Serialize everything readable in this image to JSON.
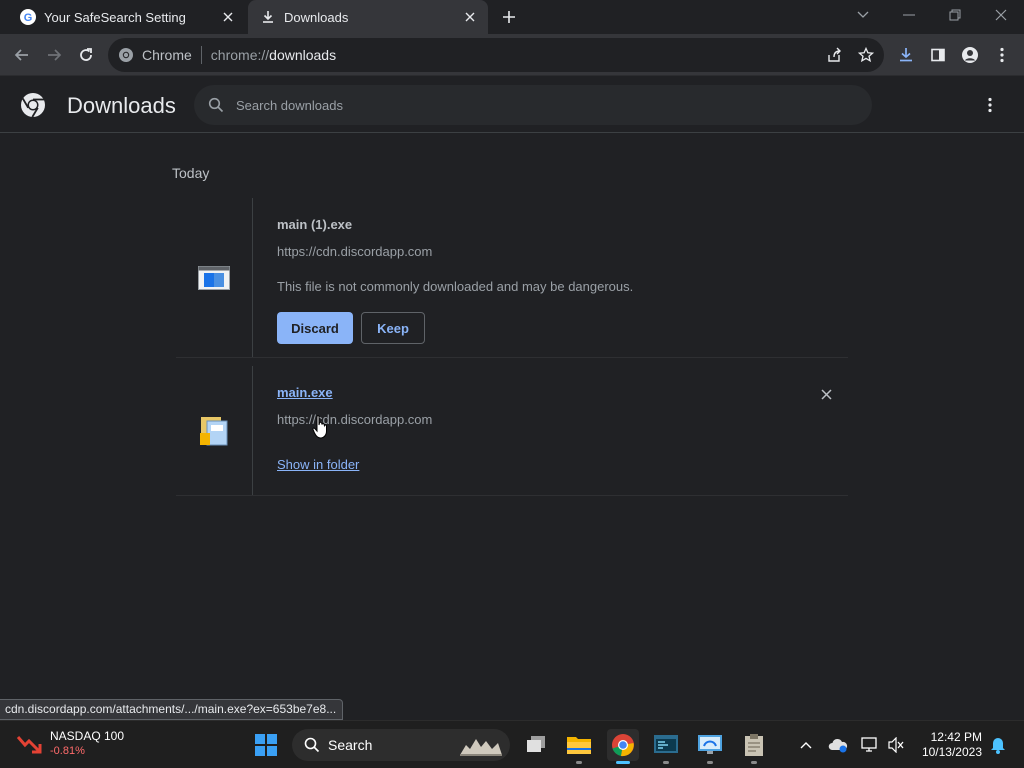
{
  "tabs": [
    {
      "title": "Your SafeSearch Setting",
      "favicon": "google-icon"
    },
    {
      "title": "Downloads",
      "favicon": "download-icon"
    }
  ],
  "omnibox": {
    "chip": "Chrome",
    "scheme": "chrome://",
    "host": "downloads"
  },
  "page": {
    "title": "Downloads",
    "search_placeholder": "Search downloads",
    "date_label": "Today"
  },
  "downloads": [
    {
      "filename": "main (1).exe",
      "url": "https://cdn.discordapp.com",
      "warning": "This file is not commonly downloaded and may be dangerous.",
      "discard_label": "Discard",
      "keep_label": "Keep"
    },
    {
      "filename": "main.exe",
      "url": "https://cdn.discordapp.com",
      "show_in_folder": "Show in folder"
    }
  ],
  "status_url": "cdn.discordapp.com/attachments/.../main.exe?ex=653be7e8...",
  "taskbar": {
    "widget_name": "NASDAQ 100",
    "widget_value": "-0.81%",
    "search_label": "Search",
    "time": "12:42 PM",
    "date": "10/13/2023"
  },
  "colors": {
    "accent": "#8ab4f8",
    "background": "#202124",
    "toolbar": "#35363a",
    "negative": "#ff6b6b"
  }
}
